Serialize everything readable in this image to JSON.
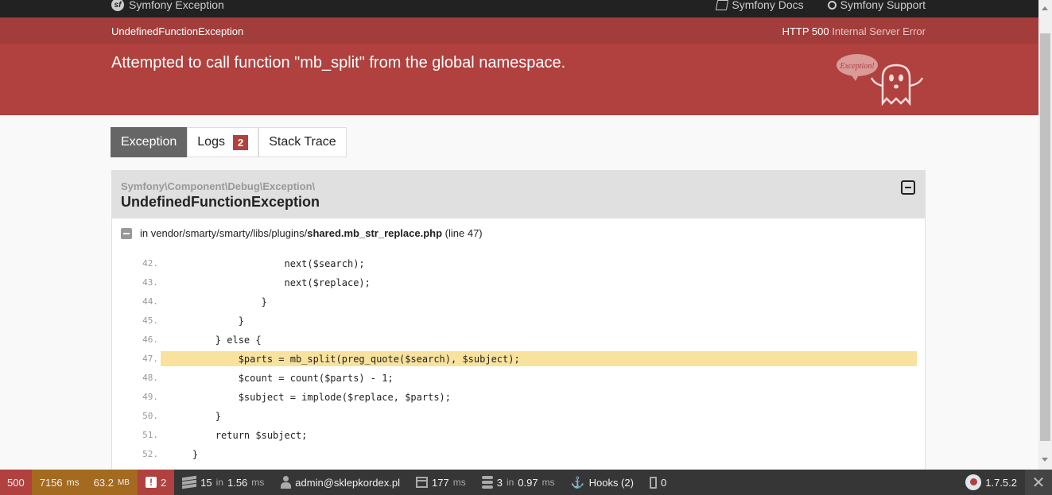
{
  "topbar": {
    "brand": "Symfony Exception",
    "docs": "Symfony Docs",
    "support": "Symfony Support"
  },
  "header": {
    "exception_class": "UndefinedFunctionException",
    "http_code": "HTTP 500",
    "http_text": "Internal Server Error",
    "message": "Attempted to call function \"mb_split\" from the global namespace.",
    "ghost_text": "Exception!"
  },
  "tabs": [
    {
      "label": "Exception"
    },
    {
      "label": "Logs",
      "badge": "2"
    },
    {
      "label": "Stack Trace"
    }
  ],
  "exception": {
    "namespace": "Symfony\\Component\\Debug\\Exception\\",
    "name": "UndefinedFunctionException",
    "file_prefix": "in vendor/smarty/smarty/libs/plugins/",
    "file_name": "shared.mb_str_replace.php",
    "line_info": "(line 47)"
  },
  "code_lines": [
    {
      "num": "42.",
      "text": "                    next($search);"
    },
    {
      "num": "43.",
      "text": "                    next($replace);"
    },
    {
      "num": "44.",
      "text": "                }"
    },
    {
      "num": "45.",
      "text": "            }"
    },
    {
      "num": "46.",
      "text": "        } else {"
    },
    {
      "num": "47.",
      "text": "            $parts = mb_split(preg_quote($search), $subject);",
      "highlight": true
    },
    {
      "num": "48.",
      "text": "            $count = count($parts) - 1;"
    },
    {
      "num": "49.",
      "text": "            $subject = implode($replace, $parts);"
    },
    {
      "num": "50.",
      "text": "        }"
    },
    {
      "num": "51.",
      "text": "        return $subject;"
    },
    {
      "num": "52.",
      "text": "    }"
    }
  ],
  "statusbar": {
    "status_code": "500",
    "time_value": "7156",
    "time_unit": "ms",
    "memory_value": "63.2",
    "memory_unit": "MB",
    "errors": "2",
    "layers_count": "15",
    "layers_in": "in",
    "layers_time": "1.56",
    "layers_unit": "ms",
    "user": "admin@sklepkordex.pl",
    "render_time": "177",
    "render_unit": "ms",
    "db_count": "3",
    "db_in": "in",
    "db_time": "0.97",
    "db_unit": "ms",
    "hooks": "Hooks (2)",
    "modules": "0",
    "version": "1.7.5.2"
  },
  "colors": {
    "header_red": "#b0413e",
    "highlight": "#f8e29d",
    "topbar": "#222222",
    "statusbar": "#363636"
  }
}
